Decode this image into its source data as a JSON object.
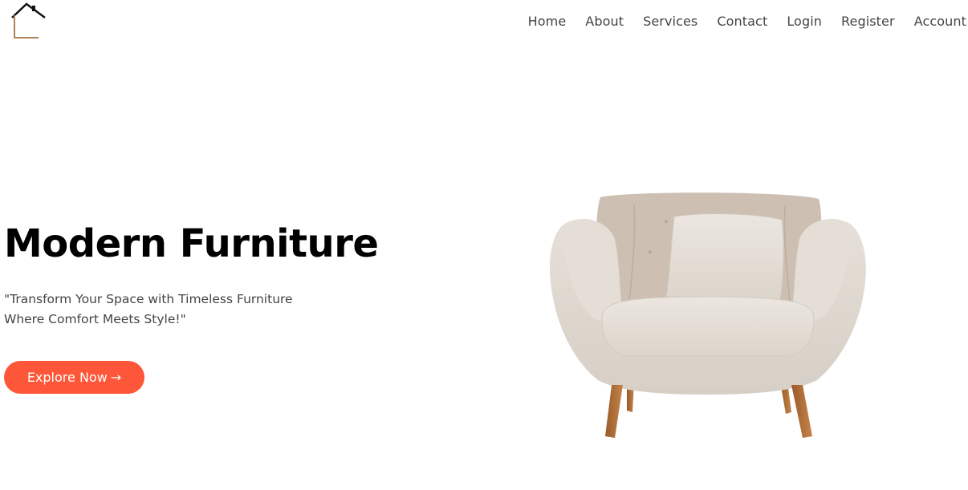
{
  "header": {
    "logo_icon": "house-outline-icon",
    "nav": [
      {
        "label": "Home"
      },
      {
        "label": "About"
      },
      {
        "label": "Services"
      },
      {
        "label": "Contact"
      },
      {
        "label": "Login"
      },
      {
        "label": "Register"
      },
      {
        "label": "Account"
      }
    ]
  },
  "hero": {
    "title": "Modern Furniture",
    "subtitle_line1": "\"Transform Your Space with Timeless Furniture",
    "subtitle_line2": "Where Comfort Meets Style!\"",
    "cta_label": "Explore Now",
    "cta_arrow": "→",
    "image_icon": "armchair-image"
  },
  "colors": {
    "accent": "#fe5638",
    "logo_roof": "#111111",
    "logo_wall": "#b08257",
    "text": "#444444",
    "heading": "#000000"
  }
}
